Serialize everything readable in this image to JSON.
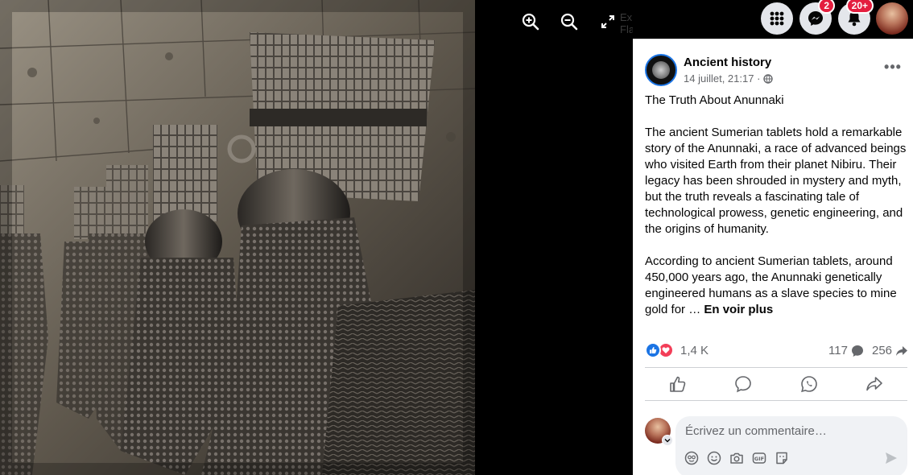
{
  "viewer": {
    "ghost_text": "Explora Flammarion",
    "tools": [
      {
        "name": "zoom-in-icon"
      },
      {
        "name": "zoom-out-icon"
      },
      {
        "name": "fullscreen-icon"
      }
    ]
  },
  "topbar": {
    "messenger_badge": "2",
    "notifications_badge": "20+"
  },
  "post": {
    "page_name": "Ancient history",
    "timestamp": "14 juillet, 21:17 ·",
    "more_label": "•••",
    "title": "The Truth About Anunnaki",
    "paragraph1": "The ancient Sumerian tablets hold a remarkable story of the Anunnaki, a race of advanced beings who visited Earth from their planet Nibiru. Their legacy has been shrouded in mystery and myth, but the truth reveals a fascinating tale of technological prowess, genetic engineering, and the origins of humanity.",
    "paragraph2": "According to ancient Sumerian tablets, around 450,000 years ago, the Anunnaki genetically engineered humans as a slave species to mine gold for … ",
    "see_more": "En voir plus"
  },
  "stats": {
    "reactions": "1,4 K",
    "comments": "117",
    "shares": "256"
  },
  "comment": {
    "placeholder": "Écrivez un commentaire…"
  },
  "colors": {
    "brand_blue": "#1b74e4",
    "love_red": "#f33e58",
    "badge_red": "#e41e3f"
  }
}
